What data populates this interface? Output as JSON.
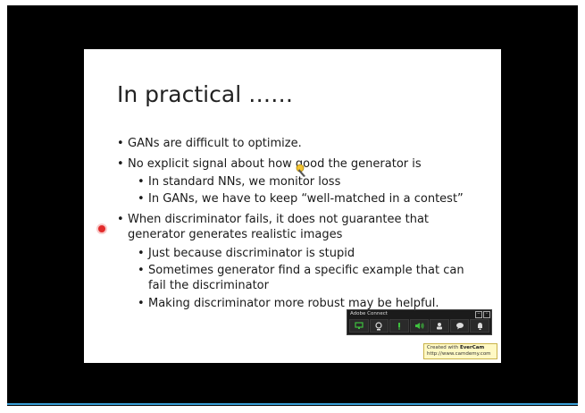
{
  "slide": {
    "title": "In practical ……",
    "bullets": [
      {
        "level": 1,
        "lines": [
          "GANs are difficult to optimize."
        ]
      },
      {
        "level": 1,
        "lines": [
          "No explicit signal about how good the generator is"
        ]
      },
      {
        "level": 2,
        "lines": [
          "In standard NNs, we monitor loss"
        ]
      },
      {
        "level": 2,
        "lines": [
          "In GANs, we have to keep “well-matched in a contest”"
        ]
      },
      {
        "level": 1,
        "lines": [
          "When discriminator fails, it does not guarantee that",
          "generator generates realistic images"
        ]
      },
      {
        "level": 2,
        "lines": [
          "Just because discriminator is stupid"
        ]
      },
      {
        "level": 2,
        "lines": [
          "Sometimes generator find a specific example that can",
          "fail the discriminator"
        ]
      },
      {
        "level": 2,
        "lines": [
          "Making discriminator more robust may be helpful."
        ]
      }
    ]
  },
  "adobe_connect": {
    "title": "Adobe Connect",
    "icons": [
      "share-screen-icon",
      "webcam-icon",
      "microphone-icon",
      "speaker-icon",
      "attendees-icon",
      "chat-icon",
      "notification-icon"
    ],
    "accent_color": "#3ec13e"
  },
  "watermark": {
    "created_with": "Created with",
    "brand": "EverCam",
    "url": "http://www.camdemy.com"
  },
  "colors": {
    "background": "#000000",
    "slide": "#ffffff",
    "laser": "#e22b2b"
  }
}
